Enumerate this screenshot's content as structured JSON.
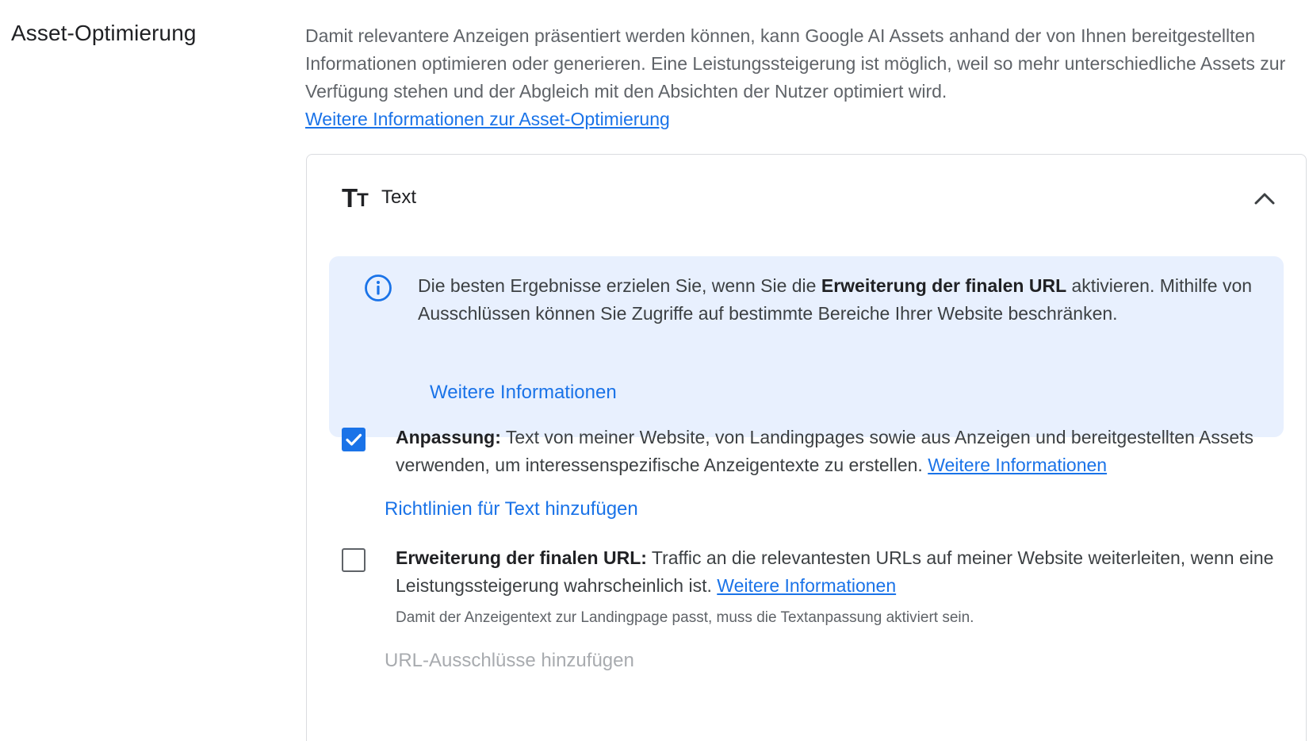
{
  "section": {
    "title": "Asset-Optimierung",
    "description": "Damit relevantere Anzeigen präsentiert werden können, kann Google AI Assets anhand der von Ihnen bereitgestellten Informationen optimieren oder generieren. Eine Leistungssteigerung ist möglich, weil so mehr unterschiedliche Assets zur Verfügung stehen und der Abgleich mit den Absichten der Nutzer optimiert wird.",
    "learn_more_link": "Weitere Informationen zur Asset-Optimierung"
  },
  "card": {
    "icon": "text-fields-icon",
    "title": "Text",
    "collapse_icon": "chevron-up-icon",
    "info_box": {
      "icon": "info-icon",
      "text_before": "Die besten Ergebnisse erzielen Sie, wenn Sie die ",
      "text_bold": "Erweiterung der finalen URL",
      "text_after": " aktivieren. Mithilfe von Ausschlüssen können Sie Zugriffe auf bestimmte Bereiche Ihrer Website beschränken.",
      "link": "Weitere Informationen"
    },
    "options": [
      {
        "checked": true,
        "label_bold": "Anpassung:",
        "label_text": " Text von meiner Website, von Landingpages sowie aus Anzeigen und bereitgestellten Assets verwenden, um interessenspezifische Anzeigentexte zu erstellen. ",
        "link": "Weitere Informationen",
        "action": "Richtlinien für Text hinzufügen"
      },
      {
        "checked": false,
        "label_bold": "Erweiterung der finalen URL:",
        "label_text": " Traffic an die relevantesten URLs auf meiner Website weiterleiten, wenn eine Leistungssteigerung wahrscheinlich ist. ",
        "link": "Weitere Informationen",
        "hint": "Damit der Anzeigentext zur Landingpage passt, muss die Textanpassung aktiviert sein.",
        "action": "URL-Ausschlüsse hinzufügen",
        "action_disabled": true
      }
    ]
  },
  "colors": {
    "accent": "#1a73e8",
    "info_bg": "#e8f0fe",
    "border": "#dadce0",
    "text": "#3c4043",
    "disabled": "#a8abaf"
  }
}
